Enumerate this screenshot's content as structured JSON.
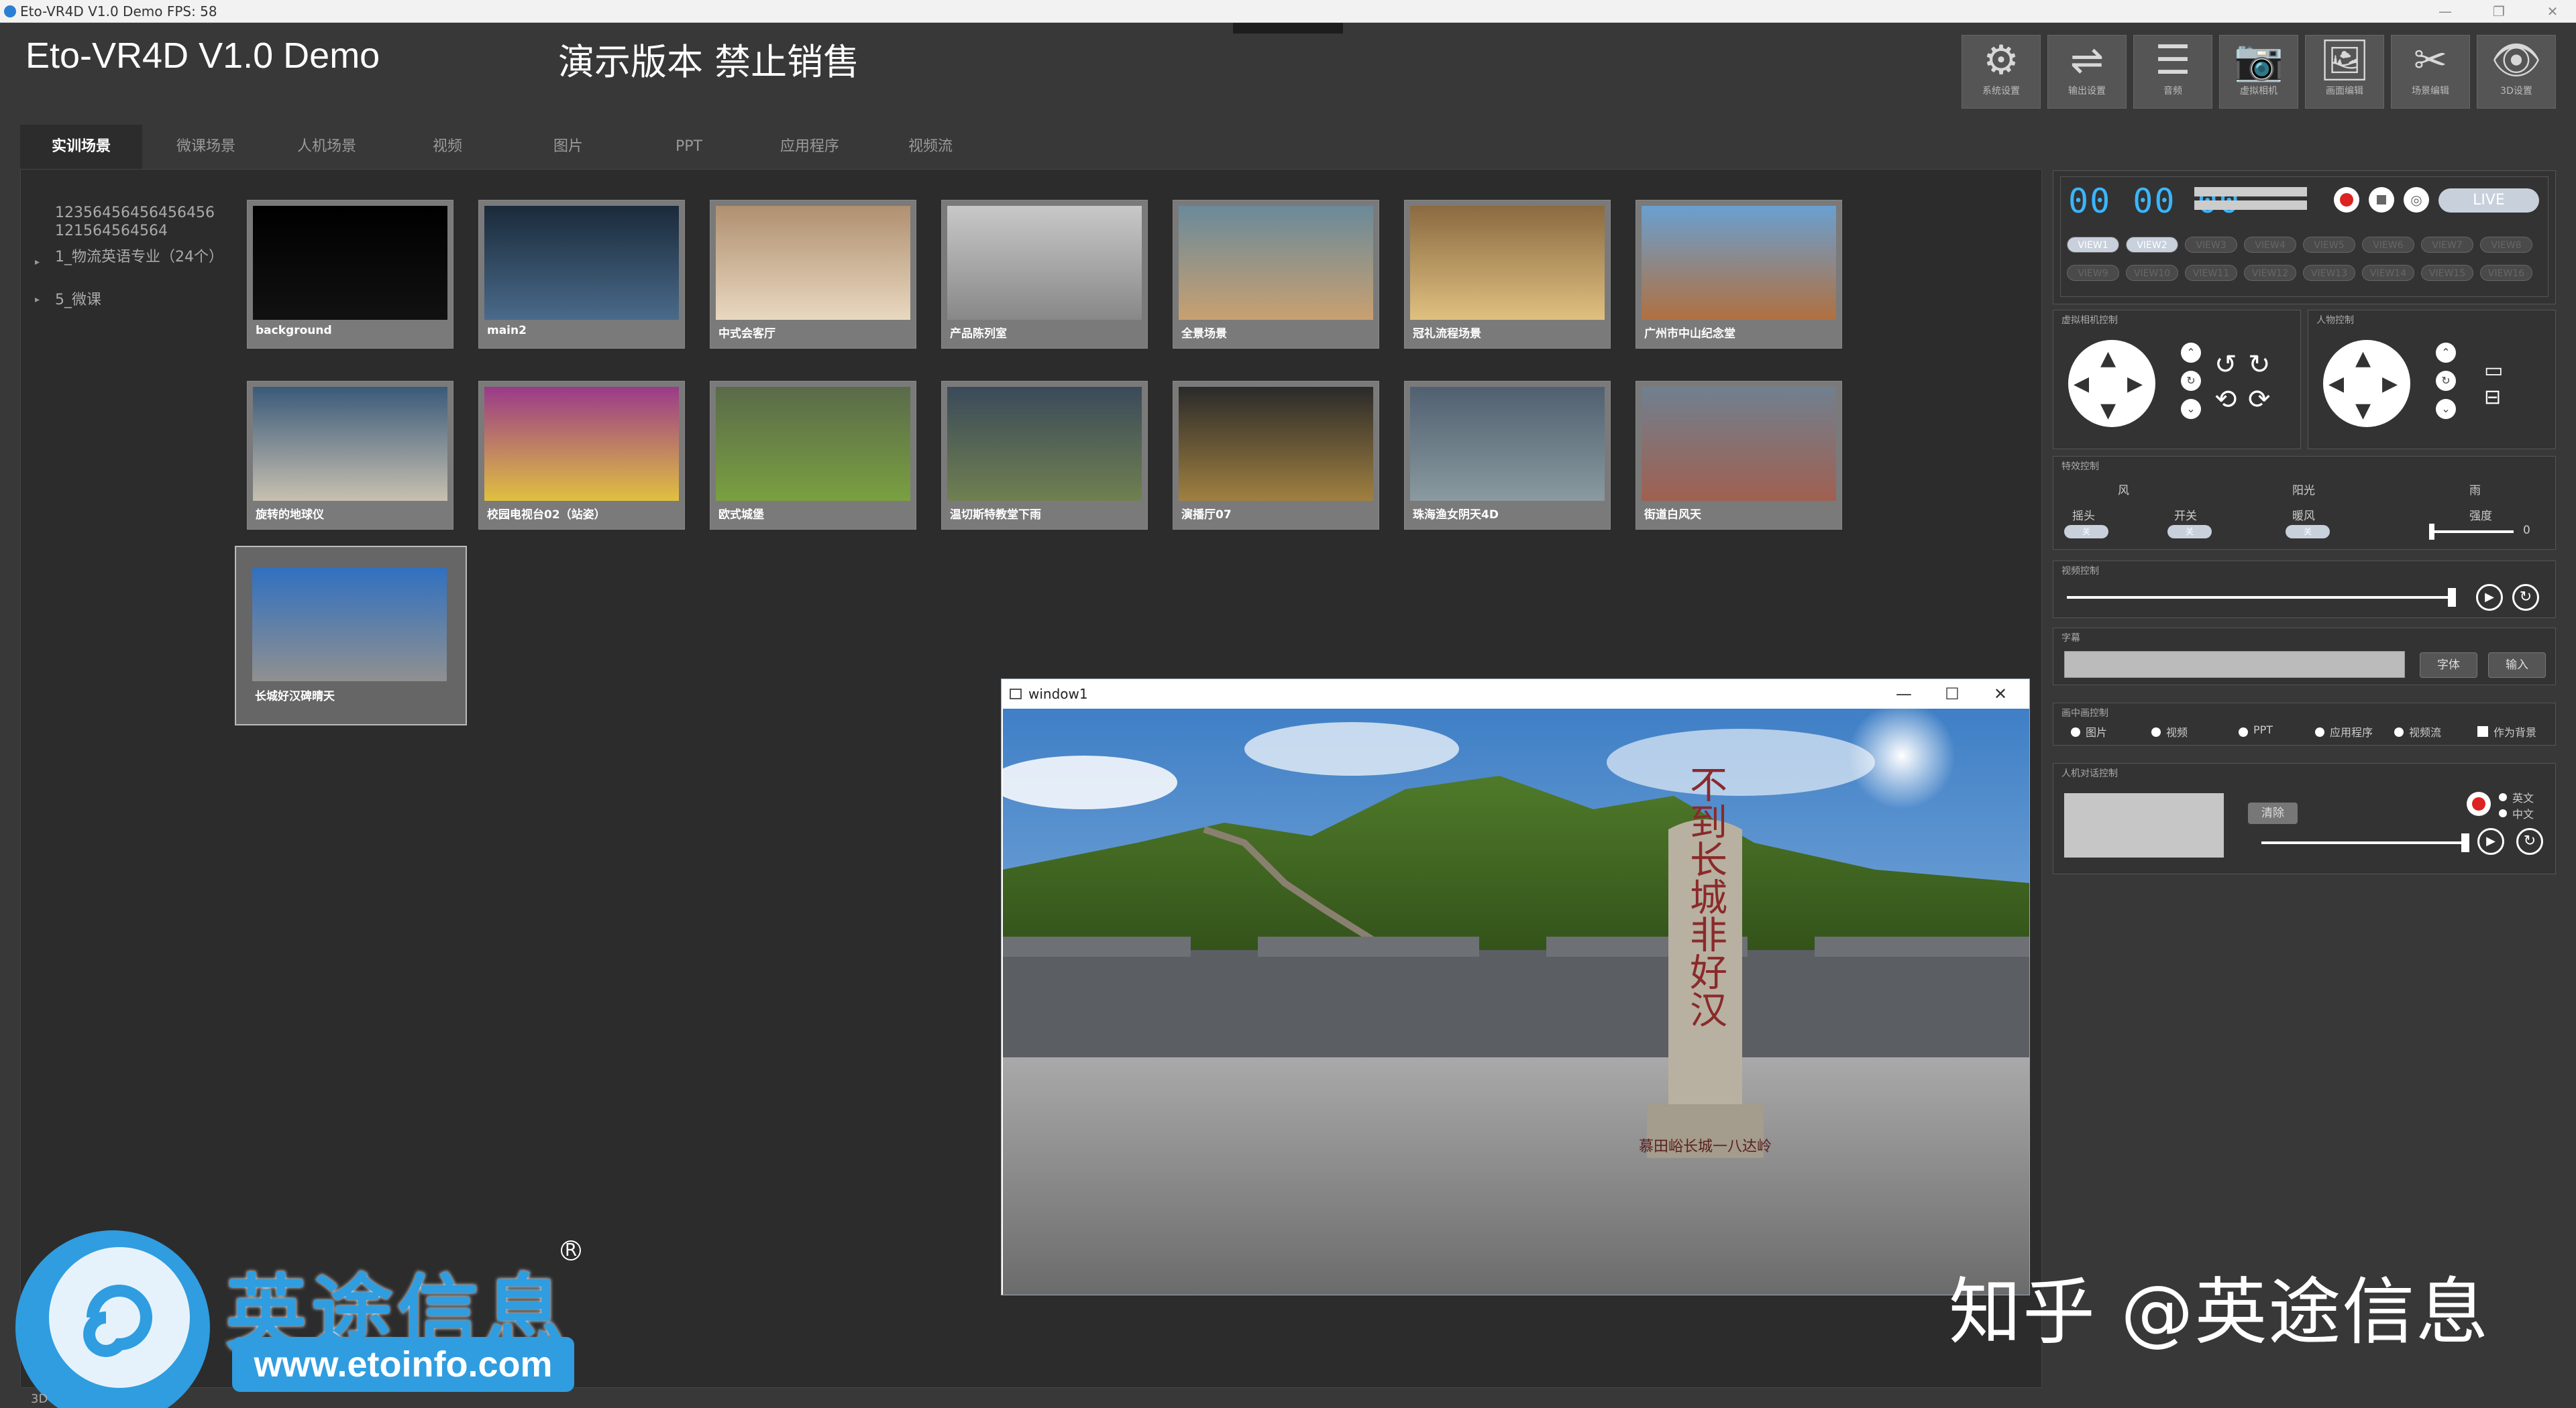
{
  "window": {
    "title": "Eto-VR4D V1.0 Demo  FPS: 58"
  },
  "app": {
    "title": "Eto-VR4D V1.0 Demo",
    "subtitle": "演示版本 禁止销售"
  },
  "toolbar": [
    {
      "label": "系统设置",
      "icon": "gear-icon",
      "glyph": "⚙"
    },
    {
      "label": "输出设置",
      "icon": "output-icon",
      "glyph": "⇌"
    },
    {
      "label": "音频",
      "icon": "sliders-icon",
      "glyph": "☰"
    },
    {
      "label": "虚拟相机",
      "icon": "camera-icon",
      "glyph": "📷"
    },
    {
      "label": "画面编辑",
      "icon": "image-icon",
      "glyph": "🖼"
    },
    {
      "label": "场景编辑",
      "icon": "tools-icon",
      "glyph": "✂"
    },
    {
      "label": "3D设置",
      "icon": "eye-icon",
      "glyph": "👁"
    }
  ],
  "tabs": [
    "实训场景",
    "微课场景",
    "人机场景",
    "视频",
    "图片",
    "PPT",
    "应用程序",
    "视频流"
  ],
  "tree": {
    "root": "12356456456456456121564564564",
    "items": [
      "1_物流英语专业（24个）",
      "5_微课"
    ]
  },
  "scenes": [
    {
      "label": "background"
    },
    {
      "label": "main2"
    },
    {
      "label": "中式会客厅"
    },
    {
      "label": "产品陈列室"
    },
    {
      "label": "全景场景"
    },
    {
      "label": "冠礼流程场景"
    },
    {
      "label": "广州市中山纪念堂"
    },
    {
      "label": "旋转的地球仪"
    },
    {
      "label": "校园电视台02（站姿）"
    },
    {
      "label": "欧式城堡"
    },
    {
      "label": "温切斯特教堂下雨"
    },
    {
      "label": "演播厅07"
    },
    {
      "label": "珠海渔女阴天4D"
    },
    {
      "label": "街道白风天"
    },
    {
      "label": "长城好汉碑晴天"
    }
  ],
  "output": {
    "timecode": "00 00 00",
    "live": "LIVE",
    "views": [
      "VIEW1",
      "VIEW2",
      "VIEW3",
      "VIEW4",
      "VIEW5",
      "VIEW6",
      "VIEW7",
      "VIEW8"
    ],
    "views2": [
      "VIEW9",
      "VIEW10",
      "VIEW11",
      "VIEW12",
      "VIEW13",
      "VIEW14",
      "VIEW15",
      "VIEW16"
    ]
  },
  "cameraPanel": {
    "label": "虚拟相机控制"
  },
  "personPanel": {
    "label": "人物控制"
  },
  "effects": {
    "label": "特效控制",
    "wind": "风",
    "sun": "阳光",
    "rain": "雨",
    "shake": "摇头",
    "switch": "开关",
    "warm": "暖风",
    "strength": "强度",
    "strengthValue": "0",
    "off": "关"
  },
  "video": {
    "label": "视频控制"
  },
  "caption": {
    "label": "字幕",
    "font": "字体",
    "input": "输入"
  },
  "pip": {
    "label": "画中画控制",
    "options": [
      "图片",
      "视频",
      "PPT",
      "应用程序",
      "视频流"
    ],
    "bg": "作为背景"
  },
  "dialog": {
    "label": "人机对话控制",
    "clear": "清除",
    "en": "英文",
    "zh": "中文"
  },
  "preview": {
    "title": "window1",
    "inscription": "不到长城非好汉",
    "plaque": "慕田峪长城一八达岭"
  },
  "watermark": "知乎 @英途信息",
  "brand": {
    "name": "英途信息",
    "url": "www.etoinfo.com",
    "reg": "R"
  },
  "bottomleft": "3D"
}
